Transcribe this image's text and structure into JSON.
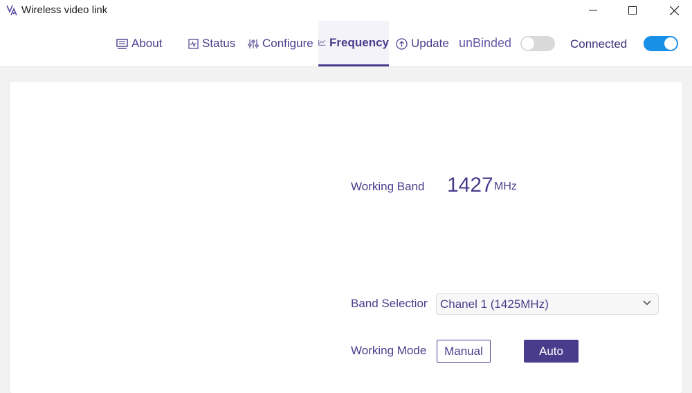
{
  "window": {
    "title": "Wireless video link"
  },
  "nav": {
    "tabs": [
      {
        "label": "About",
        "icon": "monitor-icon"
      },
      {
        "label": "Status",
        "icon": "pulse-icon"
      },
      {
        "label": "Configure",
        "icon": "sliders-icon"
      },
      {
        "label": "Frequency",
        "icon": "line-chart-icon",
        "active": true
      },
      {
        "label": "Update",
        "icon": "upload-circle-icon"
      }
    ],
    "bind_label": "unBinded",
    "bind_toggle_on": false,
    "connection_label": "Connected",
    "connection_toggle_on": true
  },
  "frequency": {
    "working_band_label": "Working Band",
    "working_band_value": "1427",
    "working_band_unit": "MHz",
    "band_selection_label": "Band Selection",
    "band_selection_value": "Chanel 1 (1425MHz)",
    "working_mode_label": "Working Mode",
    "manual_label": "Manual",
    "auto_label": "Auto",
    "selected_mode": "Auto"
  },
  "colors": {
    "accent": "#4a3c8c",
    "toggle_on": "#1890e8",
    "toggle_off": "#d9d9d9"
  }
}
